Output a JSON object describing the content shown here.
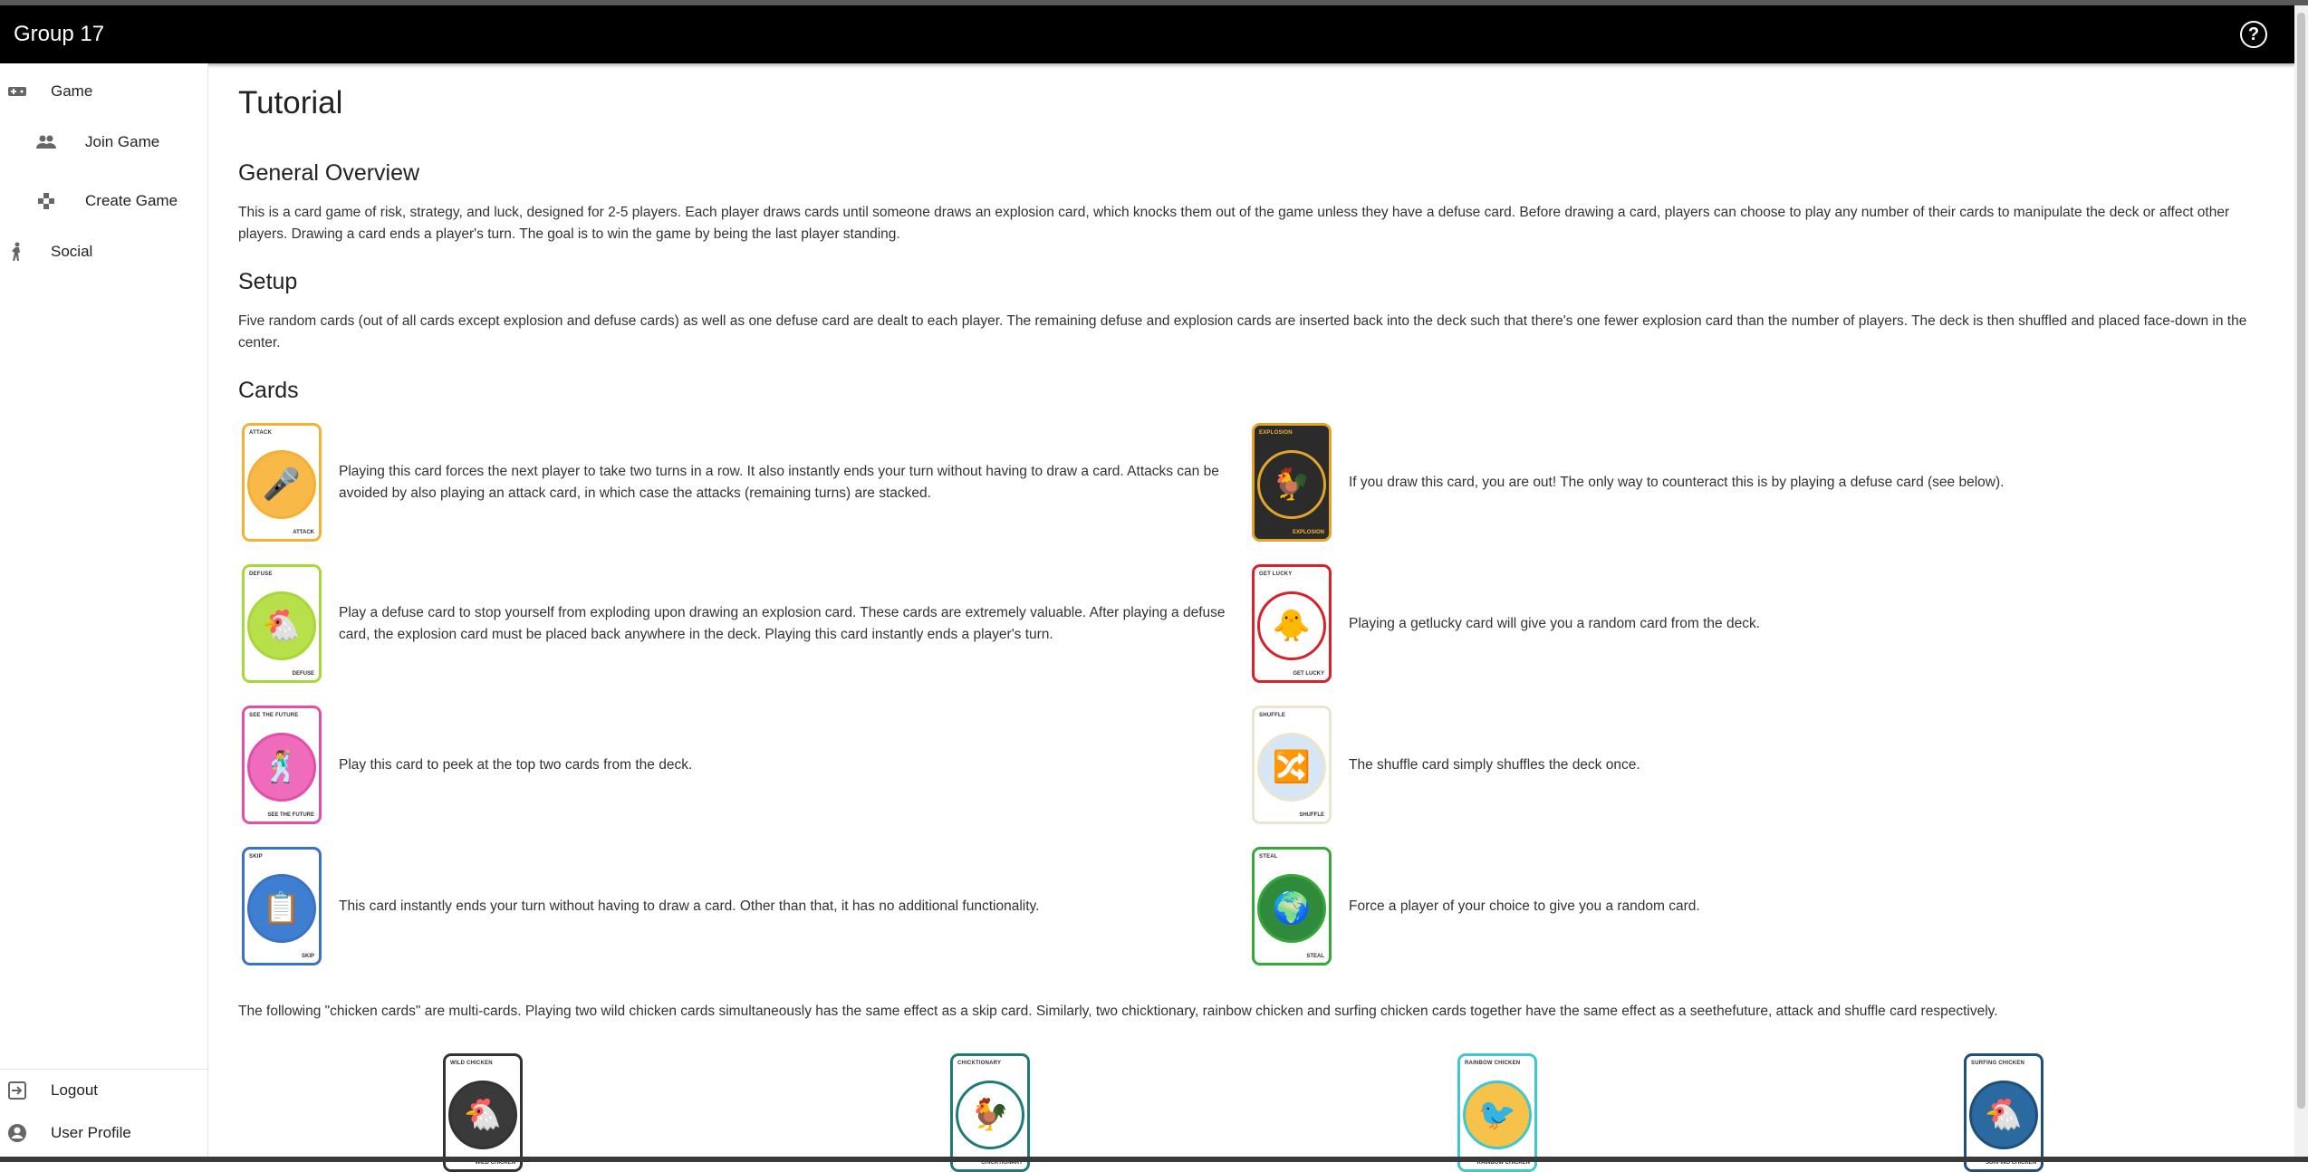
{
  "app": {
    "title": "Group 17"
  },
  "header": {
    "help_icon": "help-circle-icon"
  },
  "sidebar": {
    "items": [
      {
        "label": "Game",
        "icon": "gamepad-icon"
      },
      {
        "label": "Join Game",
        "icon": "people-icon"
      },
      {
        "label": "Create Game",
        "icon": "game-controller-icon"
      },
      {
        "label": "Social",
        "icon": "person-icon"
      }
    ],
    "bottom": [
      {
        "label": "Logout",
        "icon": "logout-icon"
      },
      {
        "label": "User Profile",
        "icon": "account-circle-icon"
      }
    ]
  },
  "page": {
    "title": "Tutorial",
    "overview_heading": "General Overview",
    "overview_text": "This is a card game of risk, strategy, and luck, designed for 2-5 players. Each player draws cards until someone draws an explosion card, which knocks them out of the game unless they have a defuse card. Before drawing a card, players can choose to play any number of their cards to manipulate the deck or affect other players. Drawing a card ends a player's turn. The goal is to win the game by being the last player standing.",
    "setup_heading": "Setup",
    "setup_text": "Five random cards (out of all cards except explosion and defuse cards) as well as one defuse card are dealt to each player. The remaining defuse and explosion cards are inserted back into the deck such that there's one fewer explosion card than the number of players. The deck is then shuffled and placed face-down in the center.",
    "cards_heading": "Cards",
    "cards": [
      {
        "name": "ATTACK",
        "desc": "Playing this card forces the next player to take two turns in a row. It also instantly ends your turn without having to draw a card. Attacks can be avoided by also playing an attack card, in which case the attacks (remaining turns) are stacked.",
        "color": "#f4b035",
        "fill": "#f9b948",
        "glyph": "🎤"
      },
      {
        "name": "EXPLOSION",
        "desc": "If you draw this card, you are out! The only way to counteract this is by playing a defuse card (see below).",
        "color": "#e0a52a",
        "fill": "#2b2b2b",
        "glyph": "🐓"
      },
      {
        "name": "DEFUSE",
        "desc": "Play a defuse card to stop yourself from exploding upon drawing an explosion card. These cards are extremely valuable. After playing a defuse card, the explosion card must be placed back anywhere in the deck. Playing this card instantly ends a player's turn.",
        "color": "#a7d83a",
        "fill": "#b8e04a",
        "glyph": "🐔"
      },
      {
        "name": "GET LUCKY",
        "desc": "Playing a getlucky card will give you a random card from the deck.",
        "color": "#d8212a",
        "fill": "#ffffff",
        "glyph": "🐥"
      },
      {
        "name": "SEE THE FUTURE",
        "desc": "Play this card to peek at the top two cards from the deck.",
        "color": "#e44fa6",
        "fill": "#ef6cbc",
        "glyph": "🕺"
      },
      {
        "name": "SHUFFLE",
        "desc": "The shuffle card simply shuffles the deck once.",
        "color": "#e9e5cf",
        "fill": "#d7e6f5",
        "glyph": "🔀"
      },
      {
        "name": "SKIP",
        "desc": "This card instantly ends your turn without having to draw a card. Other than that, it has no additional functionality.",
        "color": "#3a72c4",
        "fill": "#3f7fd1",
        "glyph": "📋"
      },
      {
        "name": "STEAL",
        "desc": "Force a player of your choice to give you a random card.",
        "color": "#36a83a",
        "fill": "#2f8a3c",
        "glyph": "🌍"
      }
    ],
    "chicken_text": "The following \"chicken cards\" are multi-cards. Playing two wild chicken cards simultaneously has the same effect as a skip card. Similarly, two chicktionary, rainbow chicken and surfing chicken cards together have the same effect as a seethefuture, attack and shuffle card respectively.",
    "chicken_cards": [
      {
        "name": "WILD CHICKEN",
        "color": "#333333",
        "fill": "#3a3a3a",
        "glyph": "🐔"
      },
      {
        "name": "CHICKTIONARY",
        "color": "#1f7a7a",
        "fill": "#ffffff",
        "glyph": "🐓"
      },
      {
        "name": "RAINBOW CHICKEN",
        "color": "#3fc8cf",
        "fill": "#f6c24a",
        "glyph": "🐦"
      },
      {
        "name": "SURFING CHICKEN",
        "color": "#1f4f7a",
        "fill": "#2a6aa0",
        "glyph": "🐔"
      }
    ]
  }
}
